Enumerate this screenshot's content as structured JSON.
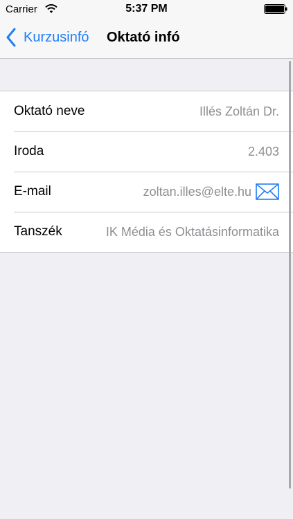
{
  "statusbar": {
    "carrier": "Carrier",
    "time": "5:37 PM"
  },
  "navbar": {
    "back_label": "Kurzusinfó",
    "title": "Oktató infó"
  },
  "rows": [
    {
      "label": "Oktató neve",
      "value": "Illés Zoltán Dr."
    },
    {
      "label": "Iroda",
      "value": "2.403"
    },
    {
      "label": "E-mail",
      "value": "zoltan.illes@elte.hu"
    },
    {
      "label": "Tanszék",
      "value": "IK Média és Oktatásinformatika"
    }
  ],
  "icons": {
    "back": "chevron-left-icon",
    "mail": "mail-icon",
    "wifi": "wifi-icon",
    "battery": "battery-icon"
  },
  "colors": {
    "accent": "#1f7dfa",
    "background": "#efeff4",
    "secondary_text": "#8e8e93"
  }
}
